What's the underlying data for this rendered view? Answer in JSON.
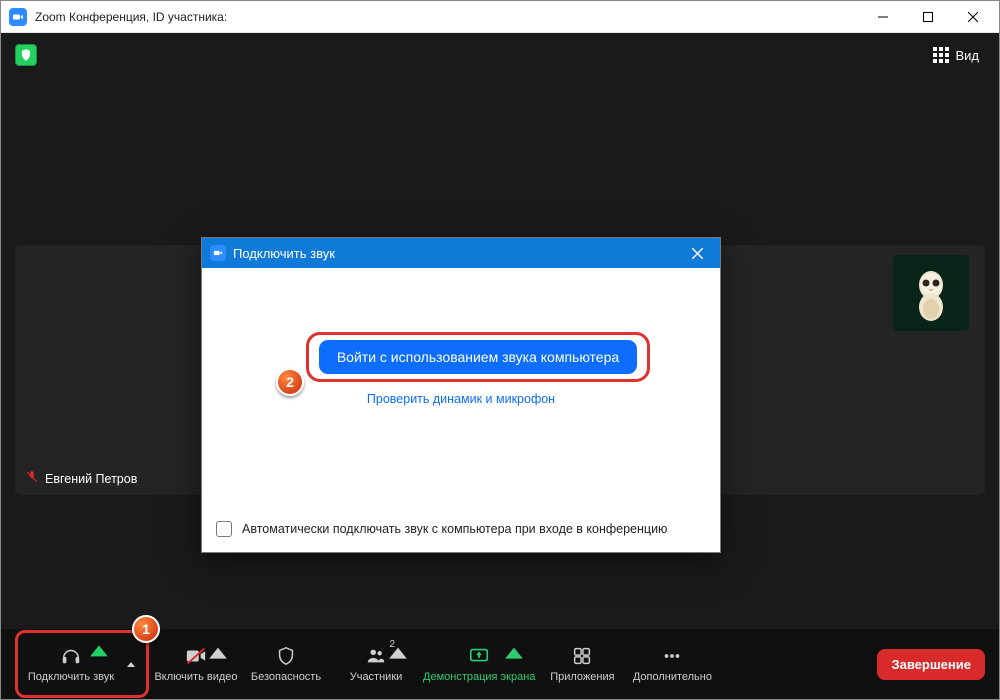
{
  "window": {
    "title": "Zoom Конференция, ID участника:"
  },
  "topbar": {
    "view_label": "Вид"
  },
  "participant": {
    "name": "Евгений Петров"
  },
  "dialog": {
    "title": "Подключить звук",
    "join_button": "Войти с использованием звука компьютера",
    "test_link": "Проверить динамик и микрофон",
    "auto_checkbox": "Автоматически подключать звук с компьютера при входе в конференцию"
  },
  "toolbar": {
    "audio": "Подключить звук",
    "video": "Включить видео",
    "security": "Безопасность",
    "participants": "Участники",
    "participants_count": "2",
    "share": "Демонстрация экрана",
    "apps": "Приложения",
    "more": "Дополнительно",
    "end": "Завершение"
  },
  "annotations": {
    "step1": "1",
    "step2": "2"
  }
}
